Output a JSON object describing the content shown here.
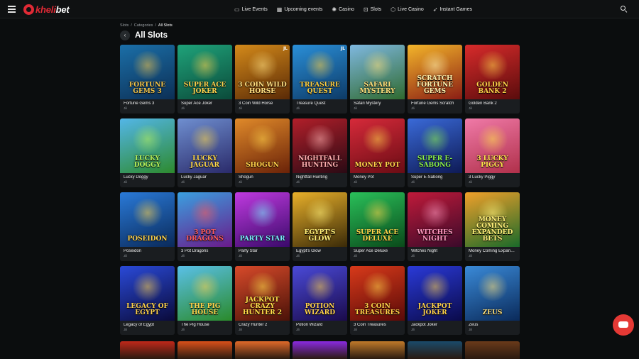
{
  "header": {
    "logo_prefix": "kheli",
    "logo_suffix": "bet",
    "nav": [
      {
        "label": "Live Events",
        "icon": "tv-icon",
        "glyph": "▭"
      },
      {
        "label": "Upcoming events",
        "icon": "calendar-icon",
        "glyph": "▦"
      },
      {
        "label": "Casino",
        "icon": "casino-chip-icon",
        "glyph": "✺"
      },
      {
        "label": "Slots",
        "icon": "slot-machine-icon",
        "glyph": "⊡"
      },
      {
        "label": "Live Casino",
        "icon": "live-casino-icon",
        "glyph": "⬡"
      },
      {
        "label": "Instant Games",
        "icon": "rocket-icon",
        "glyph": "➶"
      }
    ]
  },
  "breadcrumb": {
    "items": [
      "Slots",
      "/",
      "Categories",
      "/"
    ],
    "current": "All Slots"
  },
  "page": {
    "title": "All Slots",
    "back_glyph": "‹"
  },
  "games": [
    {
      "name": "Fortune Gems 3",
      "provider": "Jili",
      "art": "FORTUNE GEMS 3",
      "bg": "#1b6fa8",
      "bg2": "#0c2f55",
      "accent": "#f6c64a"
    },
    {
      "name": "Super Ace Joker",
      "provider": "Jili",
      "art": "SUPER ACE JOKER",
      "bg": "#1fa37a",
      "bg2": "#0b4a3a",
      "accent": "#ffd34d"
    },
    {
      "name": "3 Coin Wild Horse",
      "provider": "Jili",
      "art": "3 COIN WILD HORSE",
      "bg": "#d48a1a",
      "bg2": "#5a2a06",
      "accent": "#ffe082",
      "badge": "JL"
    },
    {
      "name": "Treasure Quest",
      "provider": "Jili",
      "art": "TREASURE QUEST",
      "bg": "#2a8fd8",
      "bg2": "#0d3a66",
      "accent": "#ffcf40",
      "badge": "JL"
    },
    {
      "name": "Safari Mystery",
      "provider": "Jili",
      "art": "SAFARI MYSTERY",
      "bg": "#7fb8e0",
      "bg2": "#2f6a2f",
      "accent": "#ffe07a"
    },
    {
      "name": "Fortune Gems Scratch",
      "provider": "Jili",
      "art": "SCRATCH FORTUNE GEMS",
      "bg": "#f3b52a",
      "bg2": "#8a1d14",
      "accent": "#fff3b0"
    },
    {
      "name": "Golden Bank 2",
      "provider": "Jili",
      "art": "GOLDEN BANK 2",
      "bg": "#d82b2b",
      "bg2": "#5a0c0c",
      "accent": "#ffd54a"
    },
    {
      "name": "Lucky Doggy",
      "provider": "Jili",
      "art": "LUCKY DOGGY",
      "bg": "#53b6e8",
      "bg2": "#2d8a2d",
      "accent": "#b8f25a"
    },
    {
      "name": "Lucky Jaguar",
      "provider": "Jili",
      "art": "LUCKY JAGUAR",
      "bg": "#6f8fd0",
      "bg2": "#2a2a6a",
      "accent": "#ffd84a"
    },
    {
      "name": "Shōgun",
      "provider": "Jili",
      "art": "SHOGUN",
      "bg": "#e08a2a",
      "bg2": "#6a2208",
      "accent": "#ffd24a"
    },
    {
      "name": "Nightfall Hunting",
      "provider": "Jili",
      "art": "NIGHTFALL HUNTING",
      "bg": "#b21f2a",
      "bg2": "#2a0a14",
      "accent": "#ffb0b0"
    },
    {
      "name": "Money Pot",
      "provider": "Jili",
      "art": "MONEY POT",
      "bg": "#d62a3a",
      "bg2": "#6a0c14",
      "accent": "#ffd54a"
    },
    {
      "name": "Super E-Sabong",
      "provider": "Jili",
      "art": "SUPER E-SABONG",
      "bg": "#3a6ad8",
      "bg2": "#0e1a55",
      "accent": "#8cf24a"
    },
    {
      "name": "3 Lucky Piggy",
      "provider": "Jili",
      "art": "3 LUCKY PIGGY",
      "bg": "#f07aa8",
      "bg2": "#b0304a",
      "accent": "#ffe34a"
    },
    {
      "name": "Poseidon",
      "provider": "Jili",
      "art": "POSEIDON",
      "bg": "#2a7ad8",
      "bg2": "#0a2a5a",
      "accent": "#ffd24a"
    },
    {
      "name": "3 Pot Dragons",
      "provider": "Jili",
      "art": "3 POT DRAGONS",
      "bg": "#3aa0e0",
      "bg2": "#6a1a8a",
      "accent": "#ff5a5a"
    },
    {
      "name": "Party Star",
      "provider": "Jili",
      "art": "PARTY STAR",
      "bg": "#c03ae0",
      "bg2": "#3a0a6a",
      "accent": "#7af0ff"
    },
    {
      "name": "Egypt's Glow",
      "provider": "Jili",
      "art": "EGYPT'S GLOW",
      "bg": "#e8b02a",
      "bg2": "#3a2a08",
      "accent": "#fff07a"
    },
    {
      "name": "Super Ace Deluxe",
      "provider": "Jili",
      "art": "SUPER ACE DELUXE",
      "bg": "#2ac05a",
      "bg2": "#0a4a1a",
      "accent": "#ffd54a"
    },
    {
      "name": "Witches Night",
      "provider": "Jili",
      "art": "WITCHES NIGHT",
      "bg": "#c01a3a",
      "bg2": "#3a0a2a",
      "accent": "#ff9ac0"
    },
    {
      "name": "Money Coming Expanded Bets",
      "provider": "Jili",
      "art": "MONEY COMING EXPANDED BETS",
      "bg": "#f0a02a",
      "bg2": "#1a6a2a",
      "accent": "#ffef7a"
    },
    {
      "name": "Legacy of Egypt",
      "provider": "Jili",
      "art": "LEGACY OF EGYPT",
      "bg": "#2a4ad8",
      "bg2": "#0a0a3a",
      "accent": "#ffd24a"
    },
    {
      "name": "The Pig House",
      "provider": "Jili",
      "art": "THE PIG HOUSE",
      "bg": "#5ac0e8",
      "bg2": "#2a8a2a",
      "accent": "#ffd24a"
    },
    {
      "name": "Crazy Hunter 2",
      "provider": "Jili",
      "art": "JACKPOT CRAZY HUNTER 2",
      "bg": "#d84a2a",
      "bg2": "#4a1208",
      "accent": "#ffe04a"
    },
    {
      "name": "Potion Wizard",
      "provider": "Jili",
      "art": "POTION WIZARD",
      "bg": "#4a4ad8",
      "bg2": "#1a0a4a",
      "accent": "#ffd24a"
    },
    {
      "name": "3 Coin Treasures",
      "provider": "Jili",
      "art": "3 COIN TREASURES",
      "bg": "#d83a1a",
      "bg2": "#5a0a08",
      "accent": "#ffd54a"
    },
    {
      "name": "Jackpot Joker",
      "provider": "Jili",
      "art": "JACKPOT JOKER",
      "bg": "#2a3ad8",
      "bg2": "#0a0a4a",
      "accent": "#ffd24a"
    },
    {
      "name": "Zeus",
      "provider": "Jili",
      "art": "ZEUS",
      "bg": "#3a8ad8",
      "bg2": "#0a2a5a",
      "accent": "#ffe07a"
    }
  ],
  "partial_row_colors": [
    "#c0281a",
    "#d8501a",
    "#e06a2a",
    "#8a2ae0",
    "#c07a2a",
    "#1a4a6a",
    "#6a3a1a"
  ],
  "chat": {
    "icon": "chat-icon"
  }
}
